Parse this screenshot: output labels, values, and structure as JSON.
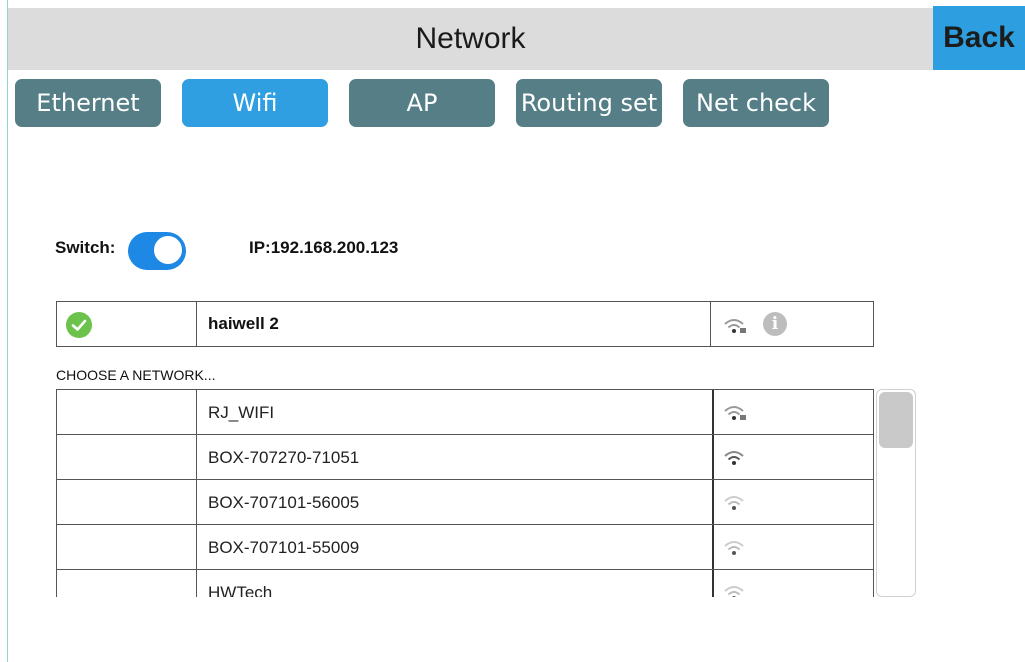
{
  "header": {
    "title": "Network",
    "back_label": "Back"
  },
  "tabs": [
    {
      "label": "Ethernet",
      "active": false
    },
    {
      "label": "Wifi",
      "active": true
    },
    {
      "label": "AP",
      "active": false
    },
    {
      "label": "Routing set",
      "active": false
    },
    {
      "label": "Net check",
      "active": false
    }
  ],
  "wifi": {
    "switch_label": "Switch:",
    "switch_on": true,
    "ip_text": "IP:192.168.200.123",
    "connected": {
      "name": "haiwell 2",
      "signal_icon": "wifi-secured-icon",
      "info_icon": "info-icon",
      "status_icon": "check-circle-icon"
    },
    "choose_label": "CHOOSE A NETWORK...",
    "networks": [
      {
        "name": "RJ_WIFI",
        "signal": "wifi-secured-icon"
      },
      {
        "name": "BOX-707270-71051",
        "signal": "wifi-strong-icon"
      },
      {
        "name": "BOX-707101-56005",
        "signal": "wifi-weak-icon"
      },
      {
        "name": "BOX-707101-55009",
        "signal": "wifi-weak-icon"
      },
      {
        "name": "HWTech",
        "signal": "wifi-weak-icon"
      }
    ]
  },
  "colors": {
    "accent": "#2f9fe2",
    "tab_inactive": "#557e86",
    "header_bg": "#dcdcdc",
    "success": "#6cc24a"
  }
}
